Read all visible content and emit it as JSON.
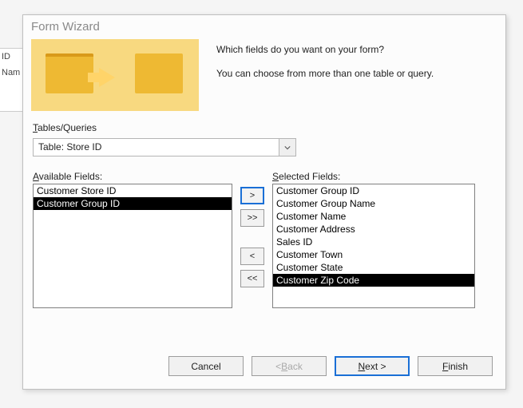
{
  "background_panel": {
    "line1": "ID",
    "line2": "Nam"
  },
  "dialog": {
    "title": "Form Wizard",
    "intro1": "Which fields do you want on your form?",
    "intro2": "You can choose from more than one table or query.",
    "tables_label_pre": "T",
    "tables_label_rest": "ables/Queries",
    "combo_value": "Table: Store ID",
    "available_label_pre": "A",
    "available_label_rest": "vailable Fields:",
    "selected_label_pre": "S",
    "selected_label_rest": "elected Fields:",
    "available_fields": [
      {
        "text": "Customer Store ID",
        "selected": false
      },
      {
        "text": "Customer Group ID",
        "selected": true
      }
    ],
    "selected_fields": [
      {
        "text": "Customer Group ID",
        "selected": false
      },
      {
        "text": "Customer Group Name",
        "selected": false
      },
      {
        "text": "Customer Name",
        "selected": false
      },
      {
        "text": "Customer Address",
        "selected": false
      },
      {
        "text": "Sales ID",
        "selected": false
      },
      {
        "text": "Customer Town",
        "selected": false
      },
      {
        "text": "Customer State",
        "selected": false
      },
      {
        "text": "Customer Zip Code",
        "selected": true
      }
    ],
    "move": {
      "add": ">",
      "add_all": ">>",
      "remove": "<",
      "remove_all": "<<"
    },
    "buttons": {
      "cancel": "Cancel",
      "back_pre": "< ",
      "back_u": "B",
      "back_rest": "ack",
      "next_u": "N",
      "next_rest": "ext >",
      "finish_u": "F",
      "finish_rest": "inish"
    }
  }
}
